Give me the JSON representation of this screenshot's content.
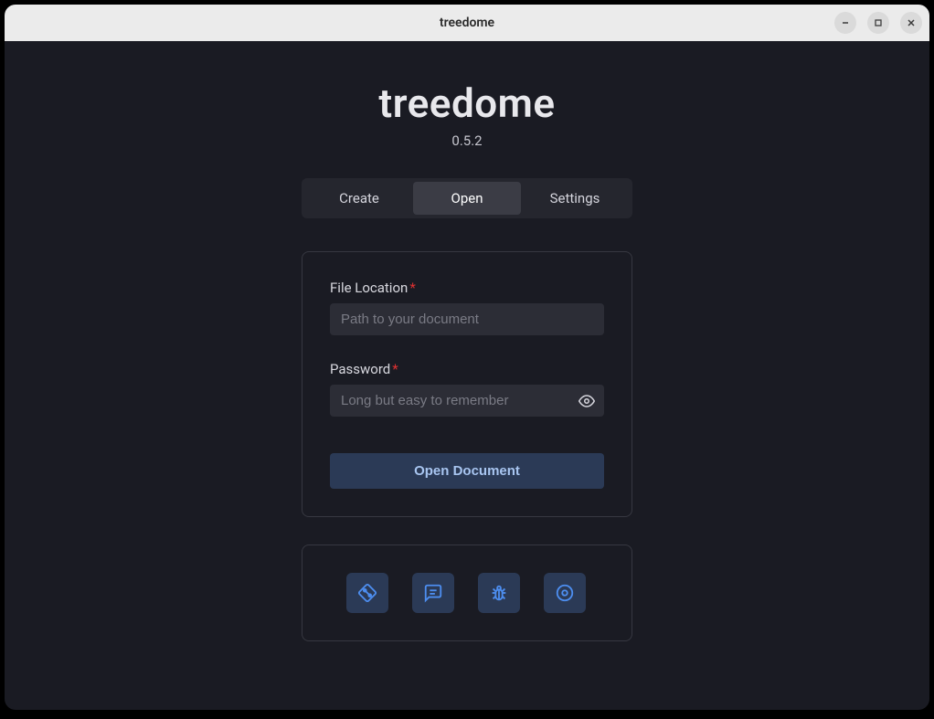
{
  "window": {
    "title": "treedome"
  },
  "app": {
    "title": "treedome",
    "version": "0.5.2"
  },
  "tabs": {
    "create": "Create",
    "open": "Open",
    "settings": "Settings",
    "active": "open"
  },
  "form": {
    "file_location": {
      "label": "File Location",
      "placeholder": "Path to your document",
      "value": ""
    },
    "password": {
      "label": "Password",
      "placeholder": "Long but easy to remember",
      "value": ""
    },
    "submit_label": "Open Document"
  },
  "links": {
    "icons": [
      "git-icon",
      "chat-icon",
      "bug-icon",
      "license-icon"
    ]
  }
}
